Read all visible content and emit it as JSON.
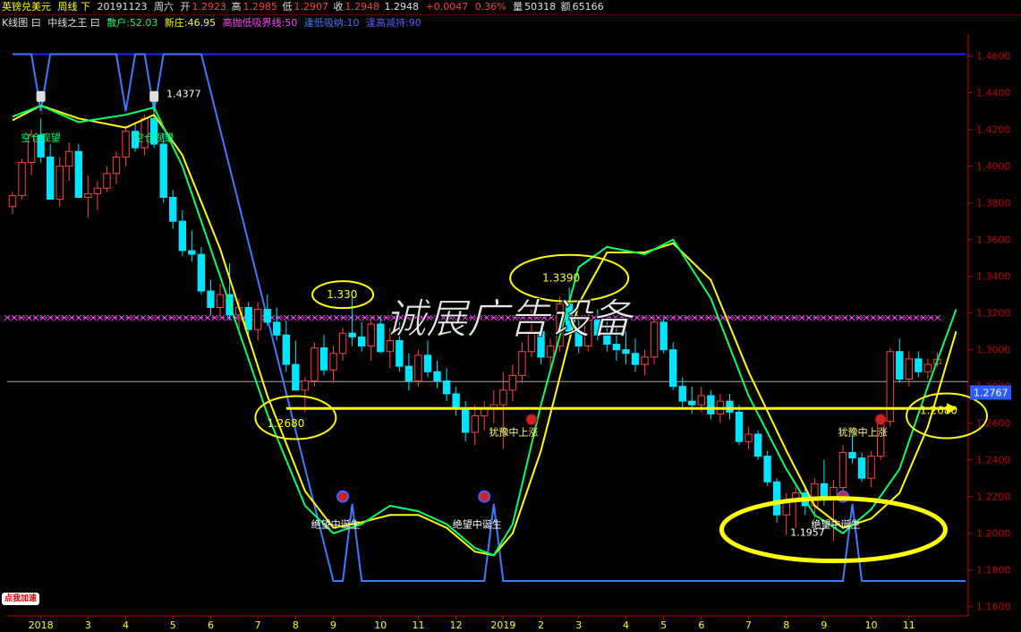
{
  "header": {
    "instrument": "英镑兑美元",
    "period": "周线 下",
    "date": "20191123",
    "weekday": "周六",
    "open_label": "开",
    "open": "1.2923",
    "high_label": "高",
    "high": "1.2985",
    "low_label": "低",
    "low": "1.2907",
    "close_label": "收",
    "close": "1.2948",
    "last": "1.2948",
    "change": "+0.0047",
    "change_pct": "0.36%",
    "volume_label": "量",
    "volume": "50318",
    "amount_label": "额",
    "amount": "65166"
  },
  "indicators": {
    "mode": "K线图 曰",
    "name": "中线之王 曰",
    "retail": "散户:52.03",
    "new": "新庄:46.95",
    "boundary": "高抛低吸界线:50",
    "low_buy": "逢低吸纳:10",
    "high_sell": "逢高减持:90"
  },
  "ui": {
    "promo": "点我加速"
  },
  "colors": {
    "up": "#ff4040",
    "down": "#00e5ff",
    "fast_line": "#00ff66",
    "slow_line": "#ffff00",
    "signal_line": "#3a7bff",
    "top_line": "#2222ff",
    "boundary": "#ff44ff",
    "axis": "#c00000",
    "annotation": "#ffff00"
  },
  "chart_data": {
    "type": "candlestick",
    "y_ticks": [
      "1.4600",
      "1.4400",
      "1.4200",
      "1.4000",
      "1.3800",
      "1.3600",
      "1.3400",
      "1.3200",
      "1.3000",
      "1.2800",
      "1.2600",
      "1.2400",
      "1.2200",
      "1.2000",
      "1.1800",
      "1.1600"
    ],
    "ylim": [
      1.155,
      1.472
    ],
    "x_ticks": [
      {
        "label": "2018",
        "index": 3
      },
      {
        "label": "3",
        "index": 8
      },
      {
        "label": "4",
        "index": 12
      },
      {
        "label": "5",
        "index": 17
      },
      {
        "label": "6",
        "index": 21
      },
      {
        "label": "7",
        "index": 26
      },
      {
        "label": "8",
        "index": 30
      },
      {
        "label": "9",
        "index": 34
      },
      {
        "label": "10",
        "index": 39
      },
      {
        "label": "11",
        "index": 43
      },
      {
        "label": "12",
        "index": 47
      },
      {
        "label": "2019",
        "index": 52
      },
      {
        "label": "2",
        "index": 56
      },
      {
        "label": "3",
        "index": 60
      },
      {
        "label": "4",
        "index": 65
      },
      {
        "label": "5",
        "index": 69
      },
      {
        "label": "6",
        "index": 73
      },
      {
        "label": "7",
        "index": 78
      },
      {
        "label": "8",
        "index": 82
      },
      {
        "label": "9",
        "index": 86
      },
      {
        "label": "10",
        "index": 91
      },
      {
        "label": "11",
        "index": 95
      }
    ],
    "candles": [
      [
        1.378,
        1.386,
        1.374,
        1.384
      ],
      [
        1.384,
        1.404,
        1.382,
        1.402
      ],
      [
        1.402,
        1.42,
        1.395,
        1.417
      ],
      [
        1.417,
        1.426,
        1.402,
        1.405
      ],
      [
        1.405,
        1.412,
        1.386,
        1.382
      ],
      [
        1.382,
        1.405,
        1.378,
        1.4
      ],
      [
        1.4,
        1.413,
        1.392,
        1.408
      ],
      [
        1.408,
        1.412,
        1.39,
        1.383
      ],
      [
        1.383,
        1.395,
        1.372,
        1.385
      ],
      [
        1.385,
        1.392,
        1.376,
        1.388
      ],
      [
        1.388,
        1.4,
        1.386,
        1.396
      ],
      [
        1.396,
        1.408,
        1.39,
        1.405
      ],
      [
        1.405,
        1.422,
        1.4,
        1.419
      ],
      [
        1.419,
        1.424,
        1.408,
        1.41
      ],
      [
        1.41,
        1.428,
        1.406,
        1.426
      ],
      [
        1.426,
        1.4377,
        1.41,
        1.412
      ],
      [
        1.412,
        1.418,
        1.38,
        1.383
      ],
      [
        1.383,
        1.387,
        1.366,
        1.37
      ],
      [
        1.37,
        1.376,
        1.351,
        1.354
      ],
      [
        1.354,
        1.365,
        1.348,
        1.352
      ],
      [
        1.352,
        1.356,
        1.33,
        1.332
      ],
      [
        1.332,
        1.338,
        1.319,
        1.323
      ],
      [
        1.323,
        1.336,
        1.318,
        1.33
      ],
      [
        1.33,
        1.347,
        1.316,
        1.319
      ],
      [
        1.319,
        1.328,
        1.308,
        1.323
      ],
      [
        1.323,
        1.326,
        1.308,
        1.311
      ],
      [
        1.311,
        1.326,
        1.305,
        1.322
      ],
      [
        1.322,
        1.33,
        1.313,
        1.315
      ],
      [
        1.315,
        1.323,
        1.305,
        1.308
      ],
      [
        1.308,
        1.316,
        1.288,
        1.292
      ],
      [
        1.292,
        1.305,
        1.286,
        1.278
      ],
      [
        1.278,
        1.285,
        1.266,
        1.283
      ],
      [
        1.283,
        1.304,
        1.28,
        1.301
      ],
      [
        1.301,
        1.308,
        1.286,
        1.289
      ],
      [
        1.289,
        1.302,
        1.282,
        1.298
      ],
      [
        1.298,
        1.312,
        1.294,
        1.309
      ],
      [
        1.309,
        1.33,
        1.302,
        1.307
      ],
      [
        1.307,
        1.315,
        1.299,
        1.302
      ],
      [
        1.302,
        1.317,
        1.294,
        1.314
      ],
      [
        1.314,
        1.318,
        1.298,
        1.299
      ],
      [
        1.299,
        1.312,
        1.29,
        1.305
      ],
      [
        1.305,
        1.315,
        1.288,
        1.291
      ],
      [
        1.291,
        1.298,
        1.278,
        1.283
      ],
      [
        1.283,
        1.3,
        1.28,
        1.297
      ],
      [
        1.297,
        1.305,
        1.285,
        1.288
      ],
      [
        1.288,
        1.294,
        1.279,
        1.283
      ],
      [
        1.283,
        1.29,
        1.272,
        1.276
      ],
      [
        1.276,
        1.28,
        1.264,
        1.268
      ],
      [
        1.268,
        1.272,
        1.25,
        1.255
      ],
      [
        1.255,
        1.27,
        1.248,
        1.264
      ],
      [
        1.264,
        1.272,
        1.256,
        1.268
      ],
      [
        1.268,
        1.278,
        1.26,
        1.27
      ],
      [
        1.27,
        1.288,
        1.246,
        1.278
      ],
      [
        1.278,
        1.292,
        1.272,
        1.286
      ],
      [
        1.286,
        1.304,
        1.282,
        1.299
      ],
      [
        1.299,
        1.322,
        1.296,
        1.31
      ],
      [
        1.31,
        1.316,
        1.292,
        1.296
      ],
      [
        1.296,
        1.306,
        1.288,
        1.302
      ],
      [
        1.302,
        1.329,
        1.299,
        1.325
      ],
      [
        1.325,
        1.3339,
        1.308,
        1.31
      ],
      [
        1.31,
        1.318,
        1.298,
        1.302
      ],
      [
        1.302,
        1.32,
        1.299,
        1.316
      ],
      [
        1.316,
        1.322,
        1.305,
        1.308
      ],
      [
        1.308,
        1.318,
        1.299,
        1.303
      ],
      [
        1.303,
        1.313,
        1.294,
        1.3
      ],
      [
        1.3,
        1.31,
        1.292,
        1.298
      ],
      [
        1.298,
        1.306,
        1.288,
        1.292
      ],
      [
        1.292,
        1.3,
        1.286,
        1.296
      ],
      [
        1.296,
        1.318,
        1.292,
        1.315
      ],
      [
        1.315,
        1.317,
        1.298,
        1.3
      ],
      [
        1.3,
        1.304,
        1.278,
        1.28
      ],
      [
        1.28,
        1.285,
        1.268,
        1.272
      ],
      [
        1.272,
        1.28,
        1.265,
        1.27
      ],
      [
        1.27,
        1.28,
        1.266,
        1.275
      ],
      [
        1.275,
        1.278,
        1.262,
        1.265
      ],
      [
        1.265,
        1.276,
        1.26,
        1.272
      ],
      [
        1.272,
        1.276,
        1.262,
        1.266
      ],
      [
        1.266,
        1.27,
        1.248,
        1.25
      ],
      [
        1.25,
        1.258,
        1.246,
        1.254
      ],
      [
        1.254,
        1.256,
        1.24,
        1.242
      ],
      [
        1.242,
        1.245,
        1.226,
        1.228
      ],
      [
        1.228,
        1.23,
        1.206,
        1.21
      ],
      [
        1.21,
        1.222,
        1.199,
        1.218
      ],
      [
        1.218,
        1.226,
        1.203,
        1.222
      ],
      [
        1.222,
        1.226,
        1.21,
        1.215
      ],
      [
        1.215,
        1.23,
        1.208,
        1.227
      ],
      [
        1.227,
        1.24,
        1.215,
        1.219
      ],
      [
        1.219,
        1.229,
        1.1957,
        1.225
      ],
      [
        1.225,
        1.248,
        1.22,
        1.244
      ],
      [
        1.244,
        1.253,
        1.238,
        1.241
      ],
      [
        1.241,
        1.244,
        1.228,
        1.23
      ],
      [
        1.23,
        1.245,
        1.225,
        1.242
      ],
      [
        1.242,
        1.264,
        1.24,
        1.261
      ],
      [
        1.261,
        1.301,
        1.258,
        1.299
      ],
      [
        1.299,
        1.306,
        1.282,
        1.284
      ],
      [
        1.284,
        1.299,
        1.28,
        1.295
      ],
      [
        1.295,
        1.299,
        1.285,
        1.288
      ],
      [
        1.288,
        1.295,
        1.284,
        1.292
      ],
      [
        1.2923,
        1.2985,
        1.2907,
        1.2948
      ]
    ],
    "fast_line": [
      [
        0,
        1.427
      ],
      [
        3,
        1.433
      ],
      [
        7,
        1.424
      ],
      [
        12,
        1.428
      ],
      [
        15,
        1.432
      ],
      [
        18,
        1.4
      ],
      [
        22,
        1.34
      ],
      [
        27,
        1.265
      ],
      [
        31,
        1.215
      ],
      [
        34,
        1.2
      ],
      [
        37,
        1.205
      ],
      [
        40,
        1.215
      ],
      [
        43,
        1.212
      ],
      [
        46,
        1.205
      ],
      [
        49,
        1.192
      ],
      [
        51,
        1.188
      ],
      [
        53,
        1.205
      ],
      [
        56,
        1.27
      ],
      [
        60,
        1.345
      ],
      [
        63,
        1.356
      ],
      [
        67,
        1.352
      ],
      [
        70,
        1.36
      ],
      [
        74,
        1.328
      ],
      [
        78,
        1.275
      ],
      [
        82,
        1.235
      ],
      [
        85,
        1.21
      ],
      [
        88,
        1.2
      ],
      [
        91,
        1.213
      ],
      [
        94,
        1.235
      ],
      [
        97,
        1.28
      ],
      [
        100,
        1.322
      ]
    ],
    "slow_line": [
      [
        0,
        1.425
      ],
      [
        3,
        1.433
      ],
      [
        7,
        1.426
      ],
      [
        12,
        1.421
      ],
      [
        15,
        1.428
      ],
      [
        18,
        1.406
      ],
      [
        22,
        1.355
      ],
      [
        27,
        1.275
      ],
      [
        31,
        1.223
      ],
      [
        34,
        1.203
      ],
      [
        37,
        1.206
      ],
      [
        40,
        1.21
      ],
      [
        43,
        1.21
      ],
      [
        46,
        1.203
      ],
      [
        49,
        1.19
      ],
      [
        51,
        1.188
      ],
      [
        53,
        1.2
      ],
      [
        56,
        1.245
      ],
      [
        60,
        1.325
      ],
      [
        63,
        1.353
      ],
      [
        67,
        1.353
      ],
      [
        70,
        1.358
      ],
      [
        74,
        1.338
      ],
      [
        78,
        1.288
      ],
      [
        82,
        1.245
      ],
      [
        85,
        1.215
      ],
      [
        88,
        1.203
      ],
      [
        91,
        1.208
      ],
      [
        94,
        1.222
      ],
      [
        97,
        1.258
      ],
      [
        100,
        1.31
      ]
    ],
    "signal_line": [
      [
        0,
        1.461
      ],
      [
        2,
        1.461
      ],
      [
        3,
        1.43
      ],
      [
        4,
        1.461
      ],
      [
        11,
        1.461
      ],
      [
        12,
        1.43
      ],
      [
        13,
        1.461
      ],
      [
        14,
        1.461
      ],
      [
        15,
        1.43
      ],
      [
        16,
        1.461
      ],
      [
        20,
        1.461
      ],
      [
        34,
        1.174
      ],
      [
        35,
        1.174
      ],
      [
        36,
        1.216
      ],
      [
        37,
        1.174
      ],
      [
        49,
        1.174
      ],
      [
        50,
        1.174
      ],
      [
        51,
        1.216
      ],
      [
        52,
        1.174
      ],
      [
        87,
        1.174
      ],
      [
        88,
        1.174
      ],
      [
        89,
        1.216
      ],
      [
        90,
        1.174
      ],
      [
        101,
        1.174
      ]
    ],
    "top_line": [
      [
        0,
        1.461
      ],
      [
        101,
        1.461
      ]
    ],
    "boundary_value": 1.3175,
    "baseline_value": 1.27,
    "current_price_tag": "1.2767",
    "signals": [
      {
        "index": 35,
        "value": 1.22,
        "label": "绝望中诞生"
      },
      {
        "index": 50,
        "value": 1.22,
        "label": "绝望中诞生"
      },
      {
        "index": 88,
        "value": 1.22,
        "label": "绝望中诞生"
      },
      {
        "index": 55,
        "value": 1.262,
        "label": "犹豫中上涨"
      },
      {
        "index": 92,
        "value": 1.262,
        "label": "犹豫中上涨"
      }
    ],
    "top_markers": [
      {
        "index": 3,
        "value": 1.438,
        "label": "空仓观望"
      },
      {
        "index": 15,
        "value": 1.438,
        "label": "空仓观望"
      }
    ],
    "annotations": {
      "high_label": "1.4377",
      "low_label": "1.1957",
      "circled_values": [
        "1.330",
        "1.3390",
        "1.2680",
        "1.2680"
      ]
    },
    "watermark": "诚展广告设备"
  }
}
